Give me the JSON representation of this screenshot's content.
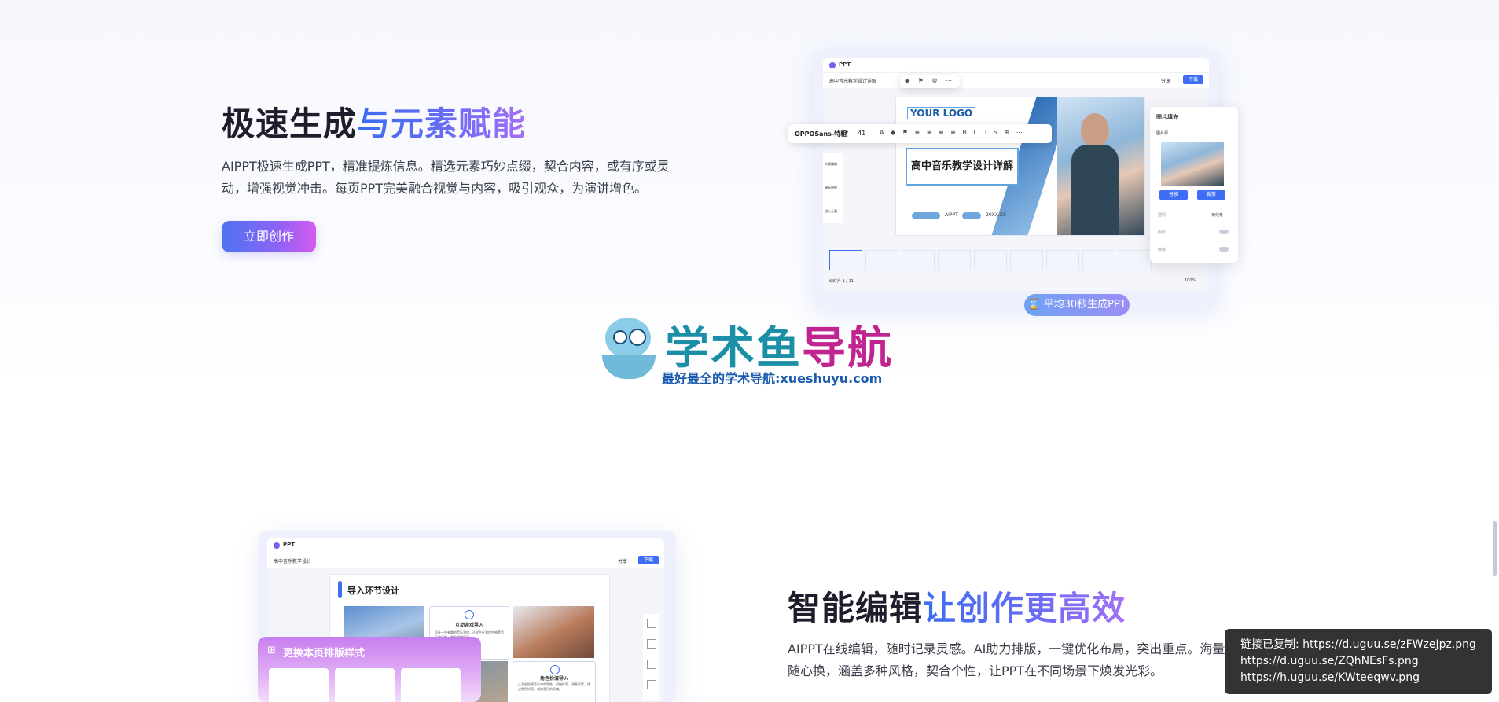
{
  "section1": {
    "title_dark": "极速生成",
    "title_accent": "与元素赋能",
    "description_line1": "AIPPT极速生成PPT，精准提炼信息。精选元素巧妙点缀，契合内容，或有序或灵",
    "description_line2": "动，增强视觉冲击。每页PPT完美融合视觉与内容，吸引观众，为演讲增色。",
    "cta_label": "立即创作",
    "mock": {
      "app_label": "PPT",
      "doc_title": "高中音乐教学设计详解",
      "share_label": "分享",
      "download_label": "下载",
      "font_name": "OPPOSans-特粗",
      "font_size": "41",
      "logo_text": "YOUR LOGO",
      "slide_title": "高中音乐教学设计详解",
      "slide_chip1": "AIPPT",
      "slide_chip2": "20XX.XX",
      "side_tools": [
        "大纲编辑",
        "模板替换",
        "插入元素"
      ],
      "panel_title": "图片填充",
      "panel_sub": "图片源",
      "panel_replace": "替换",
      "panel_crop": "裁剪",
      "panel_opt1": "透明",
      "panel_opt1_value": "无线条",
      "panel_opt2": "阴影",
      "panel_opt3": "映像",
      "page_indicator": "幻灯片 1 / 11",
      "zoom": "100%",
      "badge": "平均30秒生成PPT"
    }
  },
  "watermark": {
    "main_part1": "学术鱼",
    "main_part2": "导航",
    "sub": "最好最全的学术导航:xueshuyu.com"
  },
  "section2": {
    "title_dark": "智能编辑",
    "title_accent": "让创作更高效",
    "description_line1": "AIPPT在线编辑，随时记录灵感。AI助力排版，一键优化布局，突出重点。海量",
    "description_line2": "随心换，涵盖多种风格，契合个性，让PPT在不同场景下焕发光彩。",
    "mock": {
      "app_label": "PPT",
      "doc_title": "高中音乐教学设计",
      "share_label": "分享",
      "download_label": "下载",
      "slide_heading": "导入环节设计",
      "card1_title": "互动游戏导入",
      "card1_text": "设计一些有趣的音乐游戏，让学生在游戏中感受音乐的乐趣，激发课堂气氛。",
      "card2_title": "角色扮演导入",
      "card2_text": "让学生扮演音乐中的角色，如指挥家、演奏家等，通过角色扮演，感知音乐的灵魂。",
      "layout_popup_title": "更换本页排版样式"
    }
  },
  "toast": {
    "line1": "链接已复制: https://d.uguu.se/zFWzeJpz.png",
    "line2": "https://d.uguu.se/ZQhNEsFs.png",
    "line3": "https://h.uguu.se/KWteeqwv.png"
  },
  "colors": {
    "accent_blue": "#3a6df0",
    "accent_purple": "#a56ef7",
    "watermark_teal": "#1a8fa6",
    "watermark_magenta": "#c0248f"
  }
}
